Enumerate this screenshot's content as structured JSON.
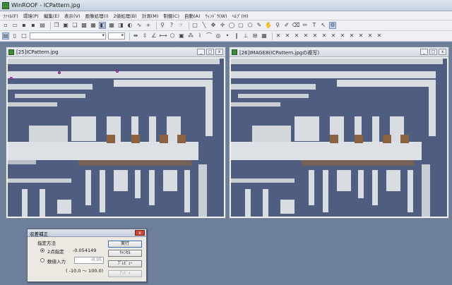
{
  "app": {
    "title": "WinROOF - ICPattern.jpg"
  },
  "menu": [
    "ﾌｧｲﾙ(F)",
    "環境(P)",
    "編集(E)",
    "表示(V)",
    "画像処理(I)",
    "2値処理(B)",
    "計測(M)",
    "制御(C)",
    "自動(A)",
    "ｳｨﾝﾄﾞｳ(W)",
    "ﾍﾙﾌﾟ(H)"
  ],
  "windows": [
    {
      "title": "[25]ICPattern.jpg"
    },
    {
      "title": "[26]IMAGE8(ICPattern.jpgの複写)"
    }
  ],
  "dialog": {
    "title": "収差補正",
    "group_label": "指定方法",
    "option_points": "2点指定",
    "points_value": "-0.054149",
    "option_numeric": "数値入力",
    "numeric_value": "-0.05",
    "range": "( -10.0 ～ 100.0)",
    "btn_execute": "実行",
    "btn_cancel": "ｷｬﾝｾﾙ",
    "btn_preview": "ﾌﾟﾚﾋﾞｭｰ",
    "btn_undo": "ｱﾝﾄﾞｩ"
  },
  "colors": {
    "workspace": "#6e7f99",
    "die": "#4f5d80",
    "metal": "#d9dde2",
    "via": "#8b6340",
    "marker": "#d25fd6"
  }
}
